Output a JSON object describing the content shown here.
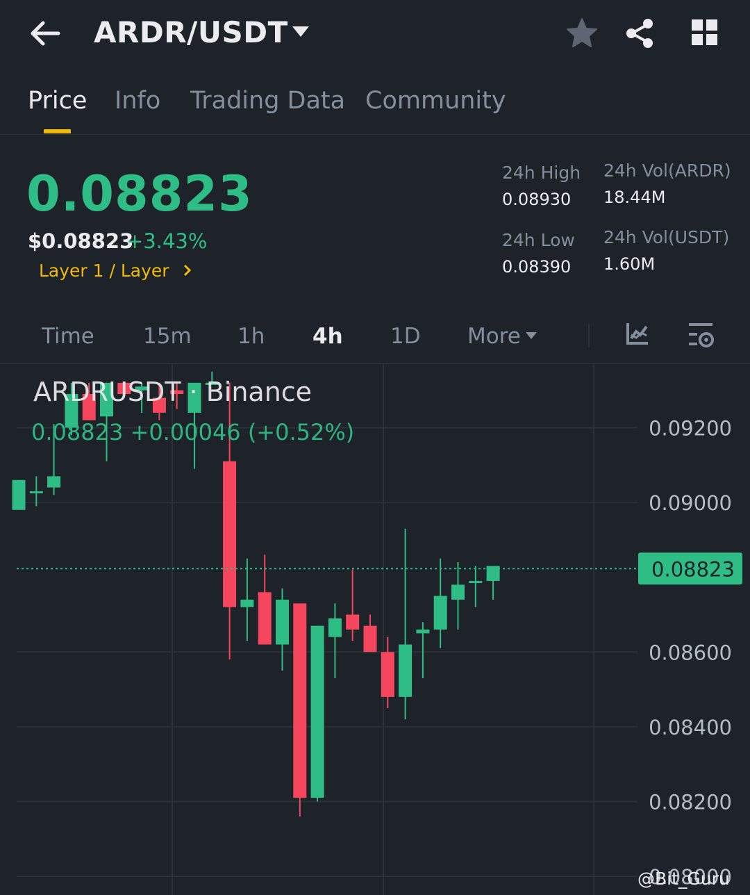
{
  "header": {
    "pair": "ARDR/USDT",
    "icons": {
      "back": "arrow-left-icon",
      "dropdown": "caret-down-icon",
      "favorite": "star-icon",
      "share": "share-icon",
      "menu": "grid-icon"
    }
  },
  "tabs": [
    {
      "label": "Price",
      "active": true
    },
    {
      "label": "Info",
      "active": false
    },
    {
      "label": "Trading Data",
      "active": false
    },
    {
      "label": "Community",
      "active": false
    }
  ],
  "ticker": {
    "last_price": "0.08823",
    "usd_price": "$0.08823",
    "change_pct": "+3.43%",
    "category": "Layer 1 / Layer",
    "high_label": "24h High",
    "high_value": "0.08930",
    "low_label": "24h Low",
    "low_value": "0.08390",
    "vol_base_label": "24h Vol(ARDR)",
    "vol_base_value": "18.44M",
    "vol_quote_label": "24h Vol(USDT)",
    "vol_quote_value": "1.60M"
  },
  "intervals": {
    "items": [
      {
        "label": "Time",
        "active": false
      },
      {
        "label": "15m",
        "active": false
      },
      {
        "label": "1h",
        "active": false
      },
      {
        "label": "4h",
        "active": true
      },
      {
        "label": "1D",
        "active": false
      },
      {
        "label": "More",
        "active": false
      }
    ],
    "icons": {
      "indicators": "chart-indicator-icon",
      "settings": "chart-settings-icon"
    }
  },
  "legend": {
    "pair": "ARDRUSDT · Binance",
    "values": "0.08823 +0.00046 (+0.52%)"
  },
  "watermark": "@Bit_Guru",
  "colors": {
    "up": "#2ebd85",
    "down": "#f6465d",
    "accent": "#f0b90b",
    "bg": "#1e2329",
    "muted": "#848e9c"
  },
  "chart_data": {
    "type": "candlestick",
    "y_ticks": [
      "0.09200",
      "0.09000",
      "0.08600",
      "0.08400",
      "0.08200",
      "0.08000"
    ],
    "ylim": [
      0.0795,
      0.0937
    ],
    "last_price": "0.08823",
    "candles": [
      {
        "o": 0.0898,
        "h": 0.0906,
        "l": 0.0898,
        "c": 0.0906
      },
      {
        "o": 0.0903,
        "h": 0.0907,
        "l": 0.0899,
        "c": 0.0903
      },
      {
        "o": 0.0904,
        "h": 0.0921,
        "l": 0.0902,
        "c": 0.0907
      },
      {
        "o": 0.092,
        "h": 0.0932,
        "l": 0.0918,
        "c": 0.0929
      },
      {
        "o": 0.0929,
        "h": 0.0932,
        "l": 0.0922,
        "c": 0.0922
      },
      {
        "o": 0.0923,
        "h": 0.0932,
        "l": 0.0911,
        "c": 0.0932
      },
      {
        "o": 0.0932,
        "h": 0.0932,
        "l": 0.0929,
        "c": 0.0929
      },
      {
        "o": 0.093,
        "h": 0.0932,
        "l": 0.0924,
        "c": 0.0931
      },
      {
        "o": 0.0928,
        "h": 0.0932,
        "l": 0.0922,
        "c": 0.0924
      },
      {
        "o": 0.093,
        "h": 0.0932,
        "l": 0.0925,
        "c": 0.0929
      },
      {
        "o": 0.0924,
        "h": 0.0932,
        "l": 0.0909,
        "c": 0.0932
      },
      {
        "o": 0.0932,
        "h": 0.0932,
        "l": 0.0935,
        "c": 0.0932
      },
      {
        "o": 0.0911,
        "h": 0.0932,
        "l": 0.0858,
        "c": 0.0872
      },
      {
        "o": 0.0872,
        "h": 0.0885,
        "l": 0.0863,
        "c": 0.0874
      },
      {
        "o": 0.0876,
        "h": 0.0886,
        "l": 0.0862,
        "c": 0.0862
      },
      {
        "o": 0.0862,
        "h": 0.0877,
        "l": 0.0855,
        "c": 0.0874
      },
      {
        "o": 0.0873,
        "h": 0.0873,
        "l": 0.0816,
        "c": 0.0821
      },
      {
        "o": 0.0821,
        "h": 0.0867,
        "l": 0.082,
        "c": 0.0867
      },
      {
        "o": 0.0864,
        "h": 0.0873,
        "l": 0.0853,
        "c": 0.0869
      },
      {
        "o": 0.087,
        "h": 0.0882,
        "l": 0.0863,
        "c": 0.0866
      },
      {
        "o": 0.0867,
        "h": 0.087,
        "l": 0.086,
        "c": 0.086
      },
      {
        "o": 0.086,
        "h": 0.0864,
        "l": 0.0845,
        "c": 0.0848
      },
      {
        "o": 0.0848,
        "h": 0.0893,
        "l": 0.0842,
        "c": 0.0862
      },
      {
        "o": 0.0865,
        "h": 0.0868,
        "l": 0.0853,
        "c": 0.0866
      },
      {
        "o": 0.0866,
        "h": 0.0885,
        "l": 0.0861,
        "c": 0.0875
      },
      {
        "o": 0.0874,
        "h": 0.0884,
        "l": 0.0866,
        "c": 0.0878
      },
      {
        "o": 0.0879,
        "h": 0.0883,
        "l": 0.0872,
        "c": 0.0879
      },
      {
        "o": 0.0879,
        "h": 0.0883,
        "l": 0.0874,
        "c": 0.0883
      }
    ]
  }
}
